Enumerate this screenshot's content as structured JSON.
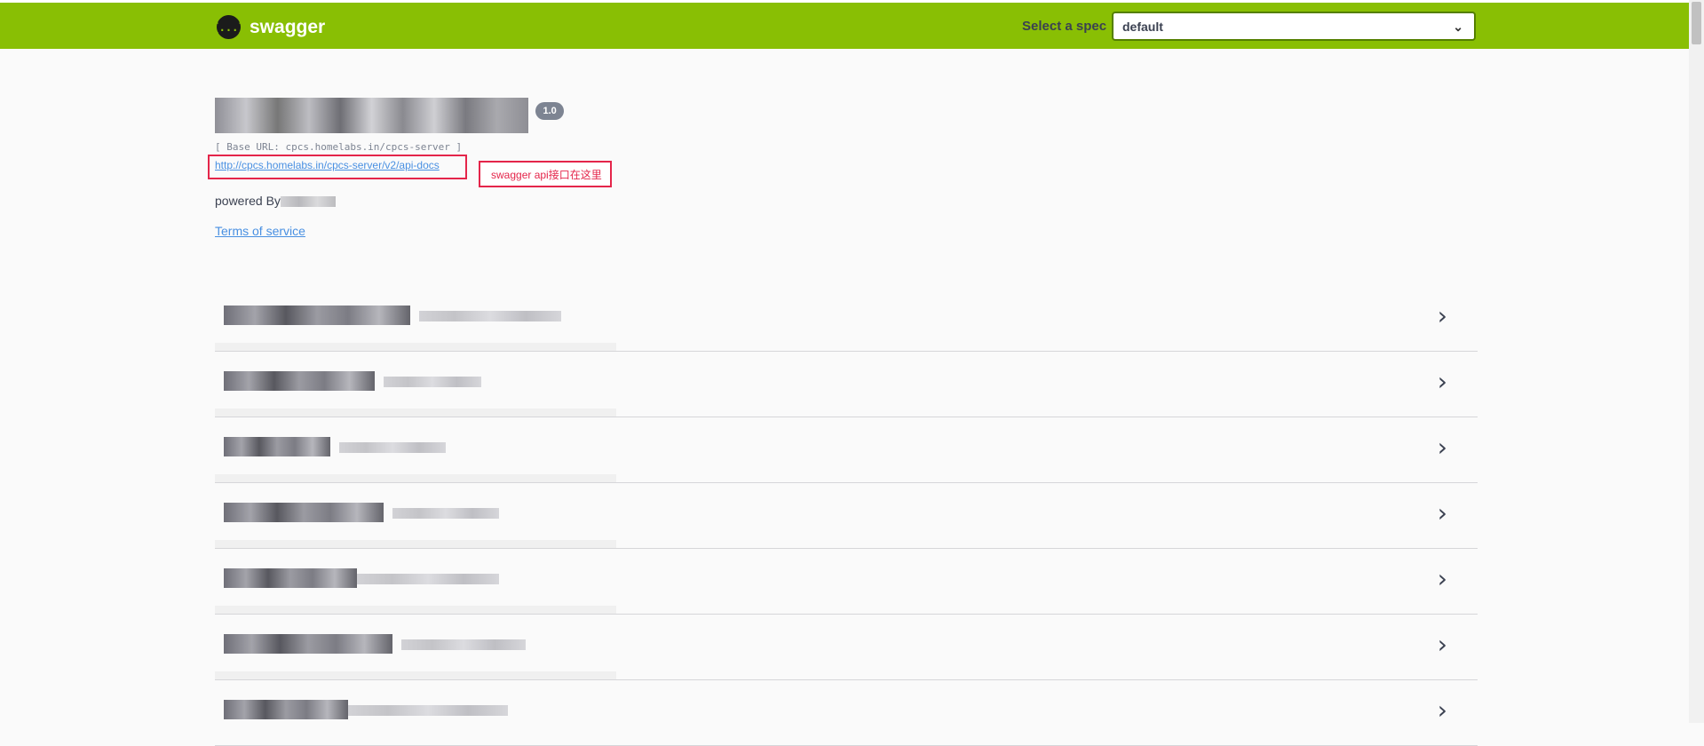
{
  "header": {
    "brand": "swagger",
    "logo_glyph": "{...}",
    "spec_label": "Select a spec",
    "spec_selected": "default"
  },
  "info": {
    "version": "1.0",
    "base_url": "[ Base URL: cpcs.homelabs.in/cpcs-server ]",
    "api_docs_link": "http://cpcs.homelabs.in/cpcs-server/v2/api-docs",
    "annotation": "swagger api接口在这里",
    "powered_by": "powered By",
    "terms": "Terms of service"
  },
  "tags": {
    "count": 7,
    "expand_glyph": "›"
  },
  "colors": {
    "topbar": "#89bf04",
    "link": "#4990e2",
    "annotation": "#e4254a"
  }
}
